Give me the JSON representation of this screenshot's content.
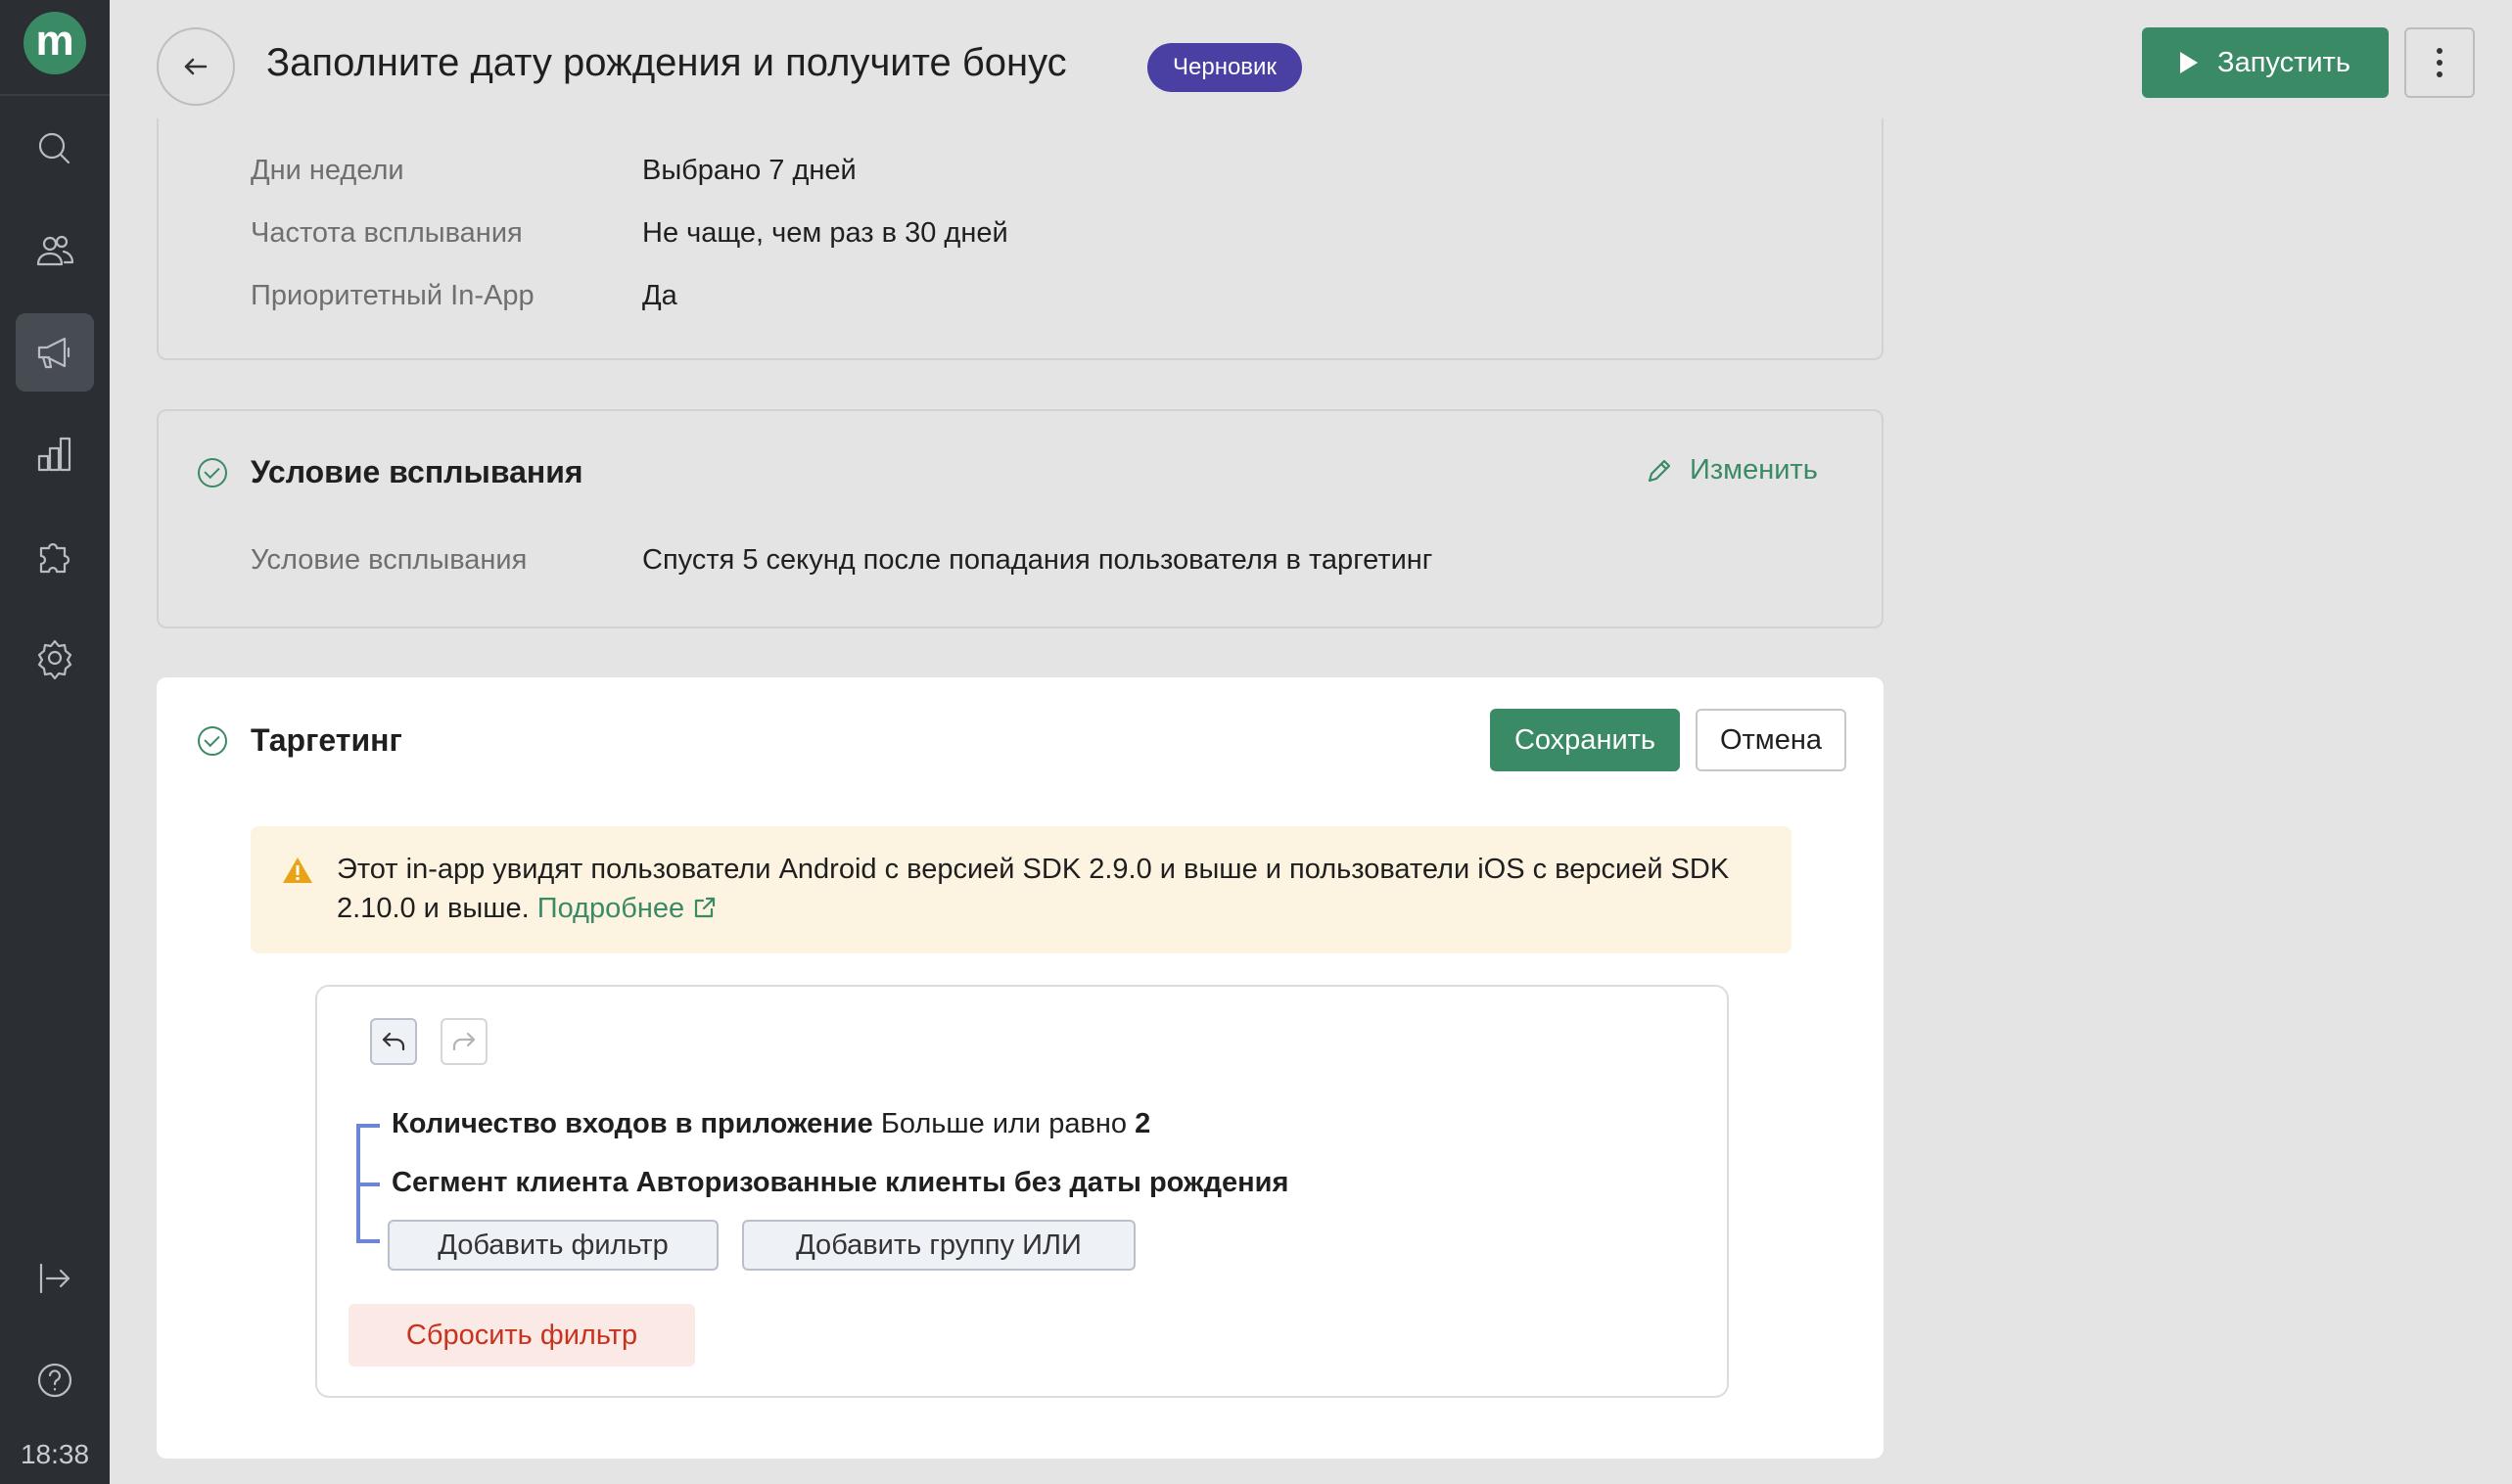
{
  "sidebar": {
    "logo": "m",
    "items": [
      {
        "icon": "search-icon"
      },
      {
        "icon": "users-icon"
      },
      {
        "icon": "megaphone-icon",
        "active": true
      },
      {
        "icon": "analytics-icon"
      },
      {
        "icon": "puzzle-icon"
      },
      {
        "icon": "gear-icon"
      }
    ],
    "bottom": [
      {
        "icon": "logout-icon"
      },
      {
        "icon": "help-icon"
      }
    ],
    "time": "18:38"
  },
  "header": {
    "title": "Заполните дату рождения и получите бонус",
    "status_badge": "Черновик",
    "run_label": "Запустить"
  },
  "schedule": {
    "rows": [
      {
        "label": "Дни недели",
        "value": "Выбрано 7 дней"
      },
      {
        "label": "Частота всплывания",
        "value": "Не чаще, чем раз в 30 дней"
      },
      {
        "label": "Приоритетный In-App",
        "value": "Да"
      }
    ]
  },
  "trigger": {
    "title": "Условие всплывания",
    "edit_label": "Изменить",
    "row": {
      "label": "Условие всплывания",
      "value": "Спустя 5 секунд после попадания пользователя в таргетинг"
    }
  },
  "targeting": {
    "title": "Таргетинг",
    "save_label": "Сохранить",
    "cancel_label": "Отмена",
    "warning_text": "Этот in-app увидят пользователи Android с версией SDK 2.9.0 и выше и пользователи iOS с версией SDK 2.10.0 и выше.",
    "warning_link": "Подробнее",
    "conditions": [
      {
        "name": "Количество входов в приложение",
        "operator": "Больше или равно",
        "value": "2"
      },
      {
        "name": "Сегмент клиента",
        "value": "Авторизованные клиенты без даты рождения"
      }
    ],
    "add_filter_label": "Добавить фильтр",
    "add_group_label": "Добавить группу ИЛИ",
    "reset_label": "Сбросить фильтр"
  },
  "colors": {
    "brand": "#3a8a65",
    "badge": "#4a3fa3",
    "sidebar": "#2b2e33",
    "warning_bg": "#fdf3e1",
    "danger": "#c8321f"
  }
}
